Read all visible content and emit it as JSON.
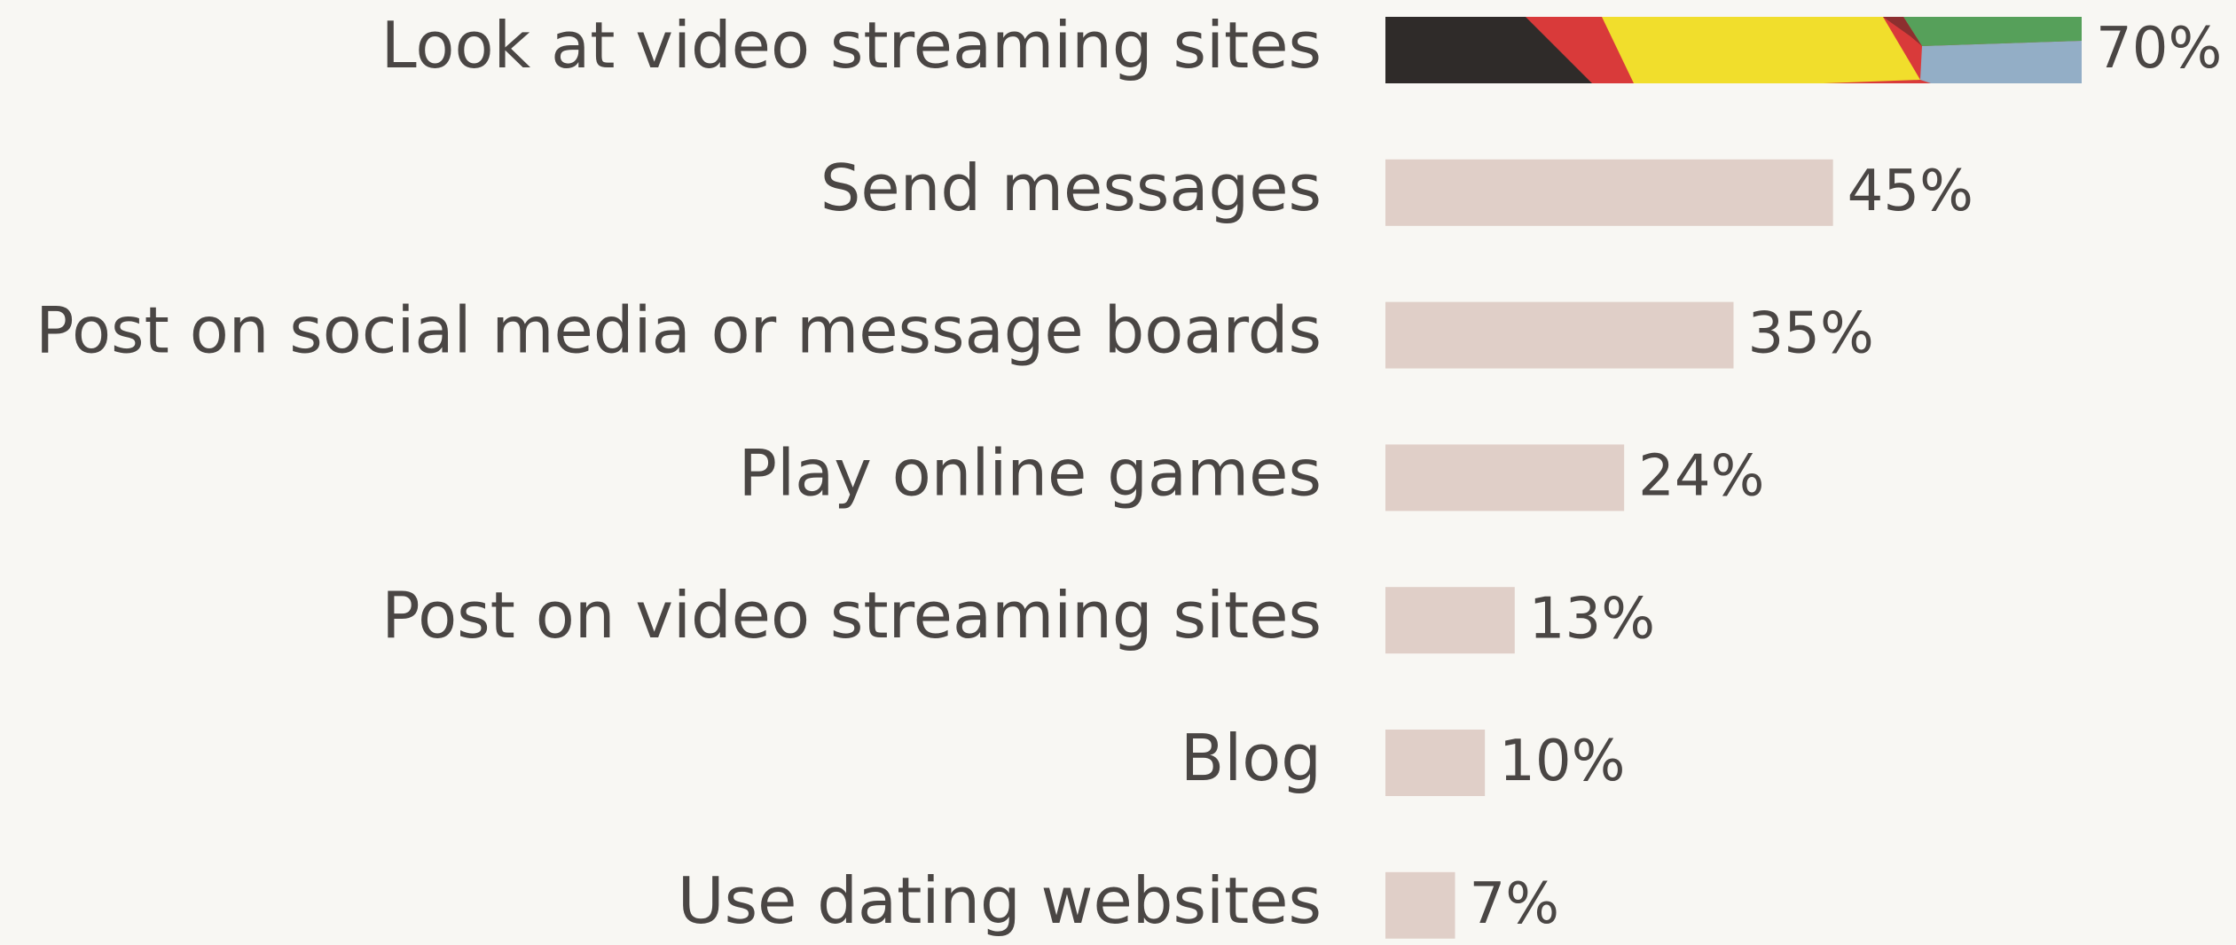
{
  "chart_data": {
    "type": "bar",
    "orientation": "horizontal",
    "categories": [
      "Look at video streaming sites",
      "Send messages",
      "Post on social media or message boards",
      "Play online games",
      "Post on video streaming sites",
      "Blog",
      "Use dating websites"
    ],
    "values": [
      70,
      45,
      35,
      24,
      13,
      10,
      7
    ],
    "value_labels": [
      "70%",
      "45%",
      "35%",
      "24%",
      "13%",
      "10%",
      "7%"
    ],
    "unit": "%",
    "xlim": [
      0,
      70
    ],
    "title": "",
    "xlabel": "",
    "ylabel": "",
    "grid": false,
    "legend": "none",
    "bar_color": "#e0cfc8",
    "highlight_bar_index": 0,
    "highlight_palette": [
      "#2f2b29",
      "#d93a3a",
      "#f1de2c",
      "#56a05a",
      "#93aec6"
    ],
    "background_color": "#f8f7f3",
    "text_color": "#4a4644"
  }
}
